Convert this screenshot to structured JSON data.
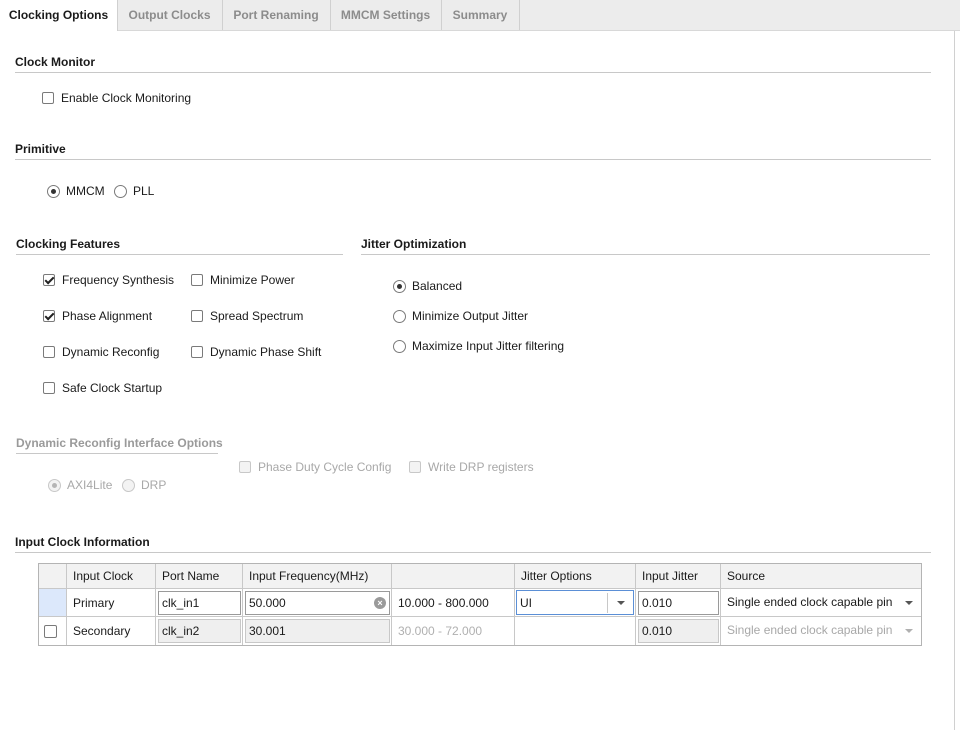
{
  "tabs": [
    "Clocking Options",
    "Output Clocks",
    "Port Renaming",
    "MMCM Settings",
    "Summary"
  ],
  "clock_monitor": {
    "title": "Clock Monitor",
    "enable_label": "Enable Clock Monitoring",
    "enable_checked": false
  },
  "primitive": {
    "title": "Primitive",
    "options": [
      "MMCM",
      "PLL"
    ],
    "selected": "MMCM"
  },
  "clocking_features": {
    "title": "Clocking Features",
    "frequency_synthesis": "Frequency Synthesis",
    "minimize_power": "Minimize Power",
    "phase_alignment": "Phase Alignment",
    "spread_spectrum": "Spread Spectrum",
    "dynamic_reconfig": "Dynamic Reconfig",
    "dynamic_phase_shift": "Dynamic Phase Shift",
    "safe_clock_startup": "Safe Clock Startup",
    "checked": [
      "Frequency Synthesis",
      "Phase Alignment"
    ]
  },
  "jitter_optimization": {
    "title": "Jitter Optimization",
    "balanced": "Balanced",
    "minimize_output": "Minimize Output Jitter",
    "maximize_input": "Maximize Input Jitter filtering",
    "selected": "Balanced"
  },
  "drp": {
    "title": "Dynamic Reconfig Interface Options",
    "phase_duty": "Phase Duty Cycle Config",
    "write_drp": "Write DRP registers",
    "axi4lite": "AXI4Lite",
    "drp_label": "DRP",
    "selected": "AXI4Lite"
  },
  "input_clock": {
    "title": "Input Clock Information",
    "headers": [
      "Input Clock",
      "Port Name",
      "Input Frequency(MHz)",
      "",
      "Jitter Options",
      "Input Jitter",
      "Source"
    ],
    "rows": [
      {
        "input_clock": "Primary",
        "port_name": "clk_in1",
        "frequency": "50.000",
        "range": "10.000 - 800.000",
        "jitter_option": "UI",
        "input_jitter": "0.010",
        "source": "Single ended clock capable pin"
      },
      {
        "input_clock": "Secondary",
        "port_name": "clk_in2",
        "frequency": "30.001",
        "range": "30.000 - 72.000",
        "jitter_option": "",
        "input_jitter": "0.010",
        "source": "Single ended clock capable pin"
      }
    ]
  },
  "colors": {
    "tab_bg": "#ececec",
    "selected_row_marker": "#dce8fb",
    "disabled_text": "#a8a8a8"
  }
}
